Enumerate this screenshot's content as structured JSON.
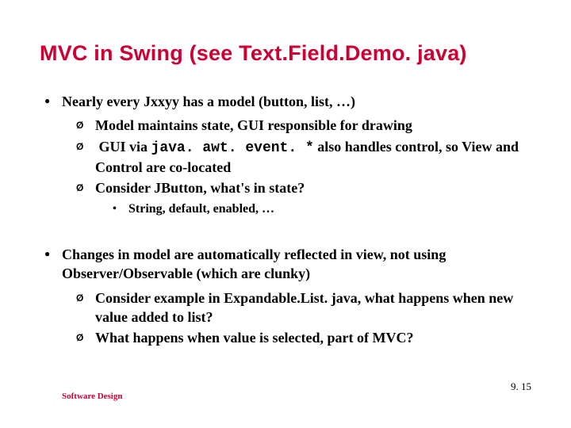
{
  "title": "MVC in Swing (see Text.Field.Demo. java)",
  "block1": {
    "heading": "Nearly every Jxxyy has a model (button, list, …)",
    "sub1": "Model maintains state, GUI responsible for drawing",
    "sub2_pre": "GUI via ",
    "sub2_code": "java. awt. event. *",
    "sub2_post": " also handles control, so View and Control are co-located",
    "sub3": "Consider JButton,  what's in state?",
    "sub3a": "String, default, enabled, …"
  },
  "block2": {
    "heading": "Changes in model are automatically reflected in view, not using Observer/Observable (which are clunky)",
    "sub1": "Consider example in Expandable.List. java, what happens when new value added to list?",
    "sub2": "What happens when value is selected, part of MVC?"
  },
  "footer": {
    "left": "Software Design",
    "right": "9. 15"
  }
}
